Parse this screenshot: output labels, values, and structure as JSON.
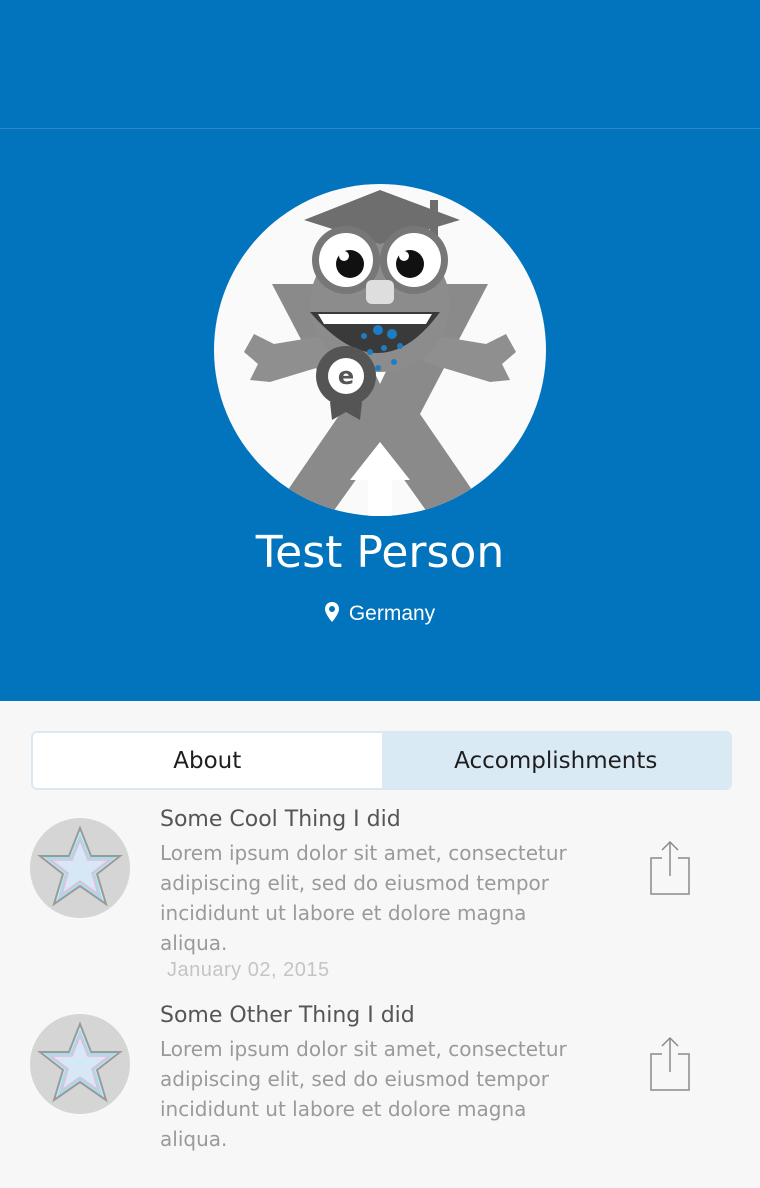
{
  "header": {
    "background_color": "#0174bd"
  },
  "profile": {
    "avatar_icon": "mascot-graduate-icon",
    "name": "Test Person",
    "location_icon": "location-pin-icon",
    "location": "Germany"
  },
  "tabs": [
    {
      "label": "About",
      "selected": false
    },
    {
      "label": "Accomplishments",
      "selected": true
    }
  ],
  "accomplishments": [
    {
      "title": "Some Cool Thing I did",
      "description": "Lorem ipsum dolor sit amet, consectetur adipiscing elit, sed do eiusmod tempor incididunt ut labore et dolore magna aliqua.",
      "date": "January 02, 2015",
      "badge_icon": "star-badge-icon",
      "share_icon": "share-icon"
    },
    {
      "title": "Some Other Thing I did",
      "description": "Lorem ipsum dolor sit amet, consectetur adipiscing elit, sed do eiusmod tempor incididunt ut labore et dolore magna aliqua.",
      "badge_icon": "star-badge-icon",
      "share_icon": "share-icon"
    }
  ]
}
